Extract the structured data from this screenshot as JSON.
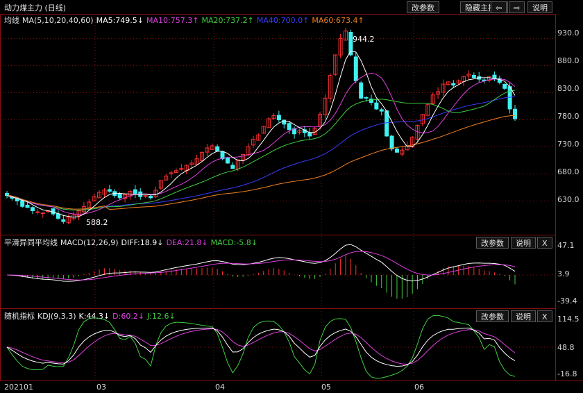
{
  "header": {
    "title": "动力煤主力 (日线)",
    "buttons": {
      "params": "改参数",
      "hide": "隐藏主指标",
      "left": "⇦",
      "right": "⇨",
      "help": "说明"
    }
  },
  "main_panel": {
    "legend": [
      {
        "text": "均线",
        "color": "#e6e6e6"
      },
      {
        "text": "MA(5,10,20,40,60)",
        "color": "#e6e6e6"
      },
      {
        "text": "MA5:749.5↓",
        "color": "#ffffff"
      },
      {
        "text": "MA10:757.3↑",
        "color": "#e040e0"
      },
      {
        "text": "MA20:737.2↑",
        "color": "#40d040"
      },
      {
        "text": "MA40:700.0↑",
        "color": "#3b3bff"
      },
      {
        "text": "MA60:673.4↑",
        "color": "#f08020"
      }
    ],
    "y_ticks": [
      "930.0",
      "880.0",
      "830.0",
      "780.0",
      "730.0",
      "680.0",
      "630.0"
    ],
    "high_label": "944.2",
    "low_label": "588.2"
  },
  "macd_panel": {
    "legend": [
      {
        "text": "平滑异同平均线",
        "color": "#e6e6e6"
      },
      {
        "text": "MACD(12,26,9)",
        "color": "#e6e6e6"
      },
      {
        "text": "DIFF:18.9↓",
        "color": "#ffffff"
      },
      {
        "text": "DEA:21.8↓",
        "color": "#e040e0"
      },
      {
        "text": "MACD:-5.8↓",
        "color": "#40d040"
      }
    ],
    "buttons": {
      "params": "改参数",
      "help": "说明",
      "close": "X"
    },
    "y_ticks": [
      "47.1",
      "3.9",
      "-39.4"
    ]
  },
  "kdj_panel": {
    "legend": [
      {
        "text": "随机指标",
        "color": "#e6e6e6"
      },
      {
        "text": "KDJ(9,3,3)",
        "color": "#e6e6e6"
      },
      {
        "text": "K:44.3↓",
        "color": "#ffffff"
      },
      {
        "text": "D:60.2↓",
        "color": "#e040e0"
      },
      {
        "text": "J:12.6↓",
        "color": "#40d040"
      }
    ],
    "buttons": {
      "params": "改参数",
      "help": "说明",
      "close": "X"
    },
    "y_ticks": [
      "114.5",
      "48.8",
      "-16.8"
    ]
  },
  "x_axis": [
    "202101",
    "03",
    "04",
    "05",
    "06"
  ],
  "colors": {
    "up": "#ff3030",
    "down": "#40f0f0",
    "grid": "#8a1010"
  },
  "chart_data": {
    "type": "candlestick",
    "price_ylim": [
      578,
      950
    ],
    "closes": [
      640,
      635,
      630,
      620,
      618,
      612,
      610,
      608,
      612,
      606,
      598,
      592,
      600,
      604,
      612,
      620,
      628,
      638,
      646,
      650,
      648,
      640,
      636,
      642,
      648,
      644,
      638,
      640,
      636,
      650,
      668,
      676,
      682,
      686,
      690,
      696,
      700,
      708,
      720,
      728,
      732,
      722,
      708,
      700,
      690,
      706,
      716,
      730,
      744,
      752,
      768,
      782,
      788,
      780,
      772,
      762,
      754,
      760,
      756,
      750,
      764,
      790,
      820,
      862,
      900,
      930,
      944,
      900,
      852,
      820,
      820,
      812,
      800,
      796,
      750,
      726,
      720,
      724,
      732,
      748,
      770,
      790,
      808,
      826,
      832,
      846,
      850,
      844,
      852,
      860,
      864,
      858,
      855,
      852,
      860,
      856,
      849,
      838,
      800,
      782
    ],
    "ma_last": {
      "MA5": 749.5,
      "MA10": 757.3,
      "MA20": 737.2,
      "MA40": 700.0,
      "MA60": 673.4
    },
    "macd_last": {
      "DIFF": 18.9,
      "DEA": 21.8,
      "MACD": -5.8
    },
    "kdj_last": {
      "K": 44.3,
      "D": 60.2,
      "J": 12.6
    }
  }
}
